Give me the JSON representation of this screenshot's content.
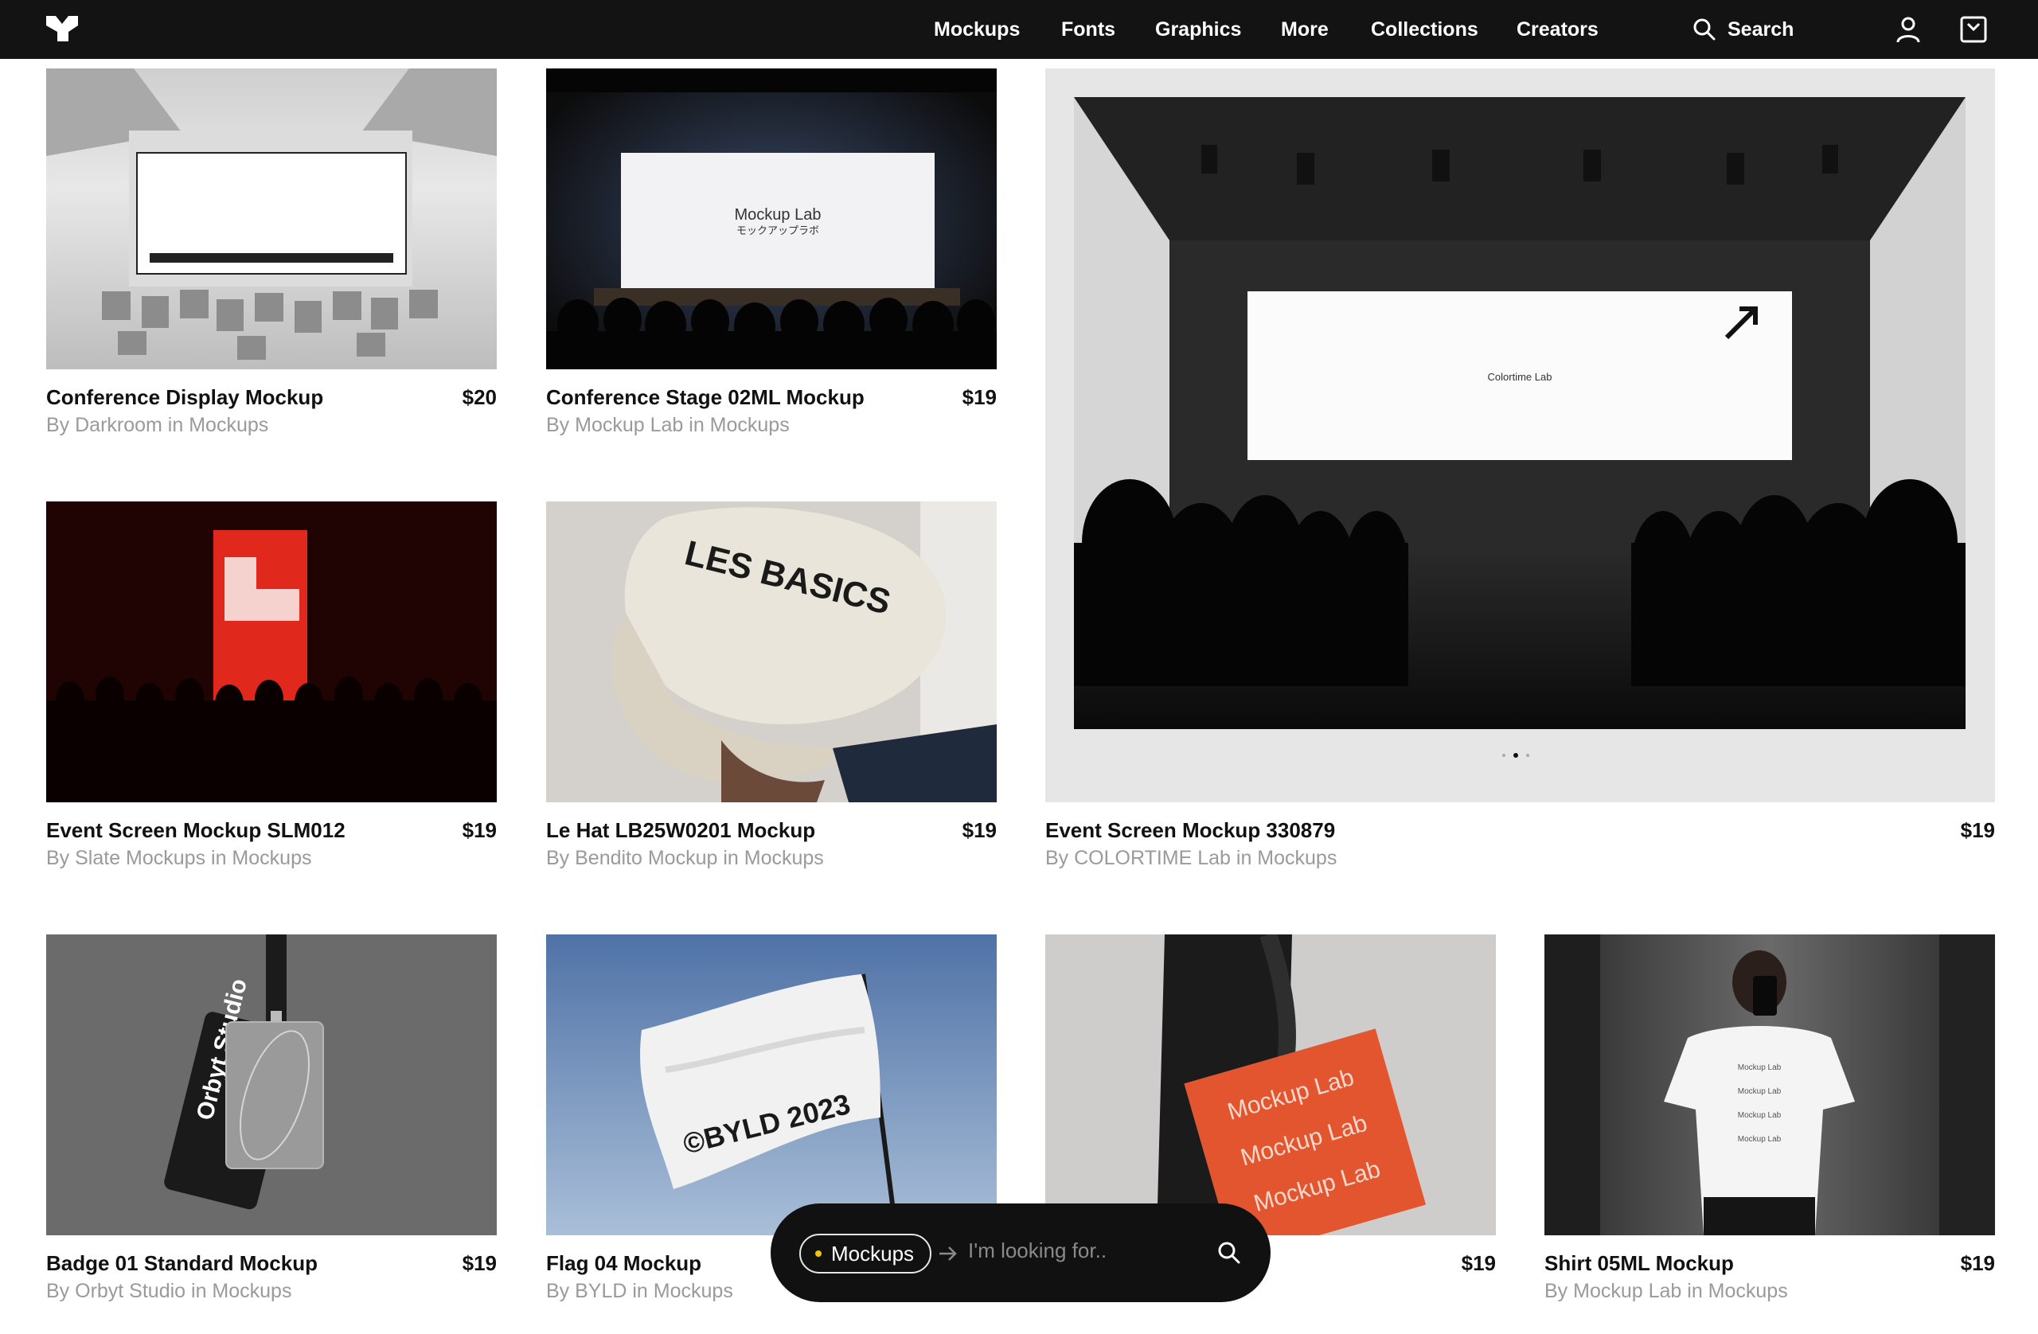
{
  "nav": {
    "items": [
      "Mockups",
      "Fonts",
      "Graphics",
      "More",
      "Collections",
      "Creators"
    ],
    "search_label": "Search"
  },
  "products": [
    {
      "title": "Conference Display Mockup",
      "price": "$20",
      "byline": "By Darkroom in Mockups"
    },
    {
      "title": "Conference Stage 02ML Mockup",
      "price": "$19",
      "byline": "By Mockup Lab in Mockups"
    },
    {
      "title": "Event Screen Mockup 330879",
      "price": "$19",
      "byline": "By COLORTIME Lab in Mockups"
    },
    {
      "title": "Event Screen Mockup SLM012",
      "price": "$19",
      "byline": "By Slate Mockups in Mockups"
    },
    {
      "title": "Le Hat LB25W0201 Mockup",
      "price": "$19",
      "byline": "By Bendito Mockup in Mockups"
    },
    {
      "title": "Badge 01 Standard Mockup",
      "price": "$19",
      "byline": "By Orbyt Studio in Mockups"
    },
    {
      "title": "Flag 04 Mockup",
      "price": "",
      "byline": "By BYLD in Mockups"
    },
    {
      "title": "",
      "price": "$19",
      "byline": ""
    },
    {
      "title": "Shirt 05ML Mockup",
      "price": "$19",
      "byline": "By Mockup Lab in Mockups"
    }
  ],
  "image_text": {
    "stage_screen": "Mockup Lab",
    "stage_screen_jp": "モックアップラボ",
    "event_screen": "Colortime Lab",
    "cap": "LES BASICS",
    "flag": "©BYLD 2023",
    "tote": "Mockup Lab",
    "badge": "Orbyt Studio"
  },
  "carousel": {
    "current": 2,
    "count": 3
  },
  "dock": {
    "chip_label": "Mockups",
    "placeholder": "I'm looking for.."
  },
  "colors": {
    "topbar": "#131313",
    "accent_dot": "#f4c400",
    "event_red": "#e0281c",
    "tote_orange": "#e2552e"
  }
}
